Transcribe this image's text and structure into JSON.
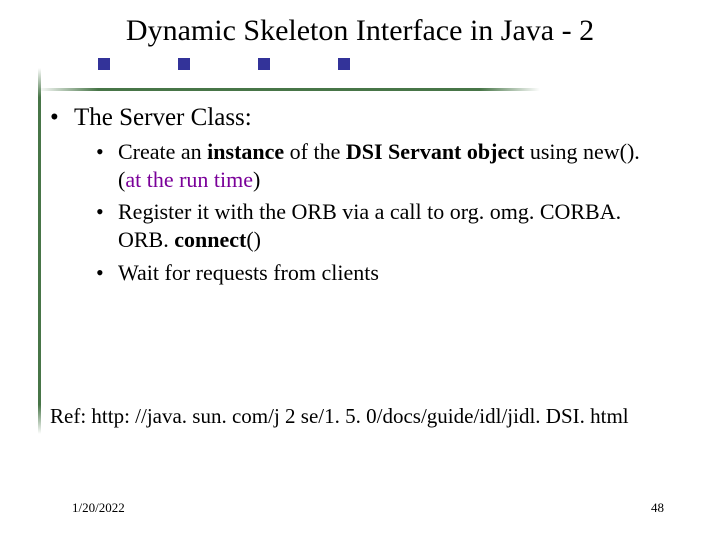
{
  "title": "Dynamic Skeleton Interface in Java - 2",
  "heading": {
    "marker": "•",
    "text": "The Server Class:"
  },
  "bullets": [
    {
      "marker": "•",
      "pre": "Create an ",
      "bold1": "instance",
      "mid": " of the ",
      "bold2": "DSI Servant object",
      "post1": " using new(). (",
      "runtime": "at the run time",
      "post2": ")"
    },
    {
      "marker": "•",
      "pre": "Register it with the ORB via a call to org. omg. CORBA. ORB. ",
      "bold": "connect",
      "post": "()"
    },
    {
      "marker": "•",
      "text": "Wait for requests from clients"
    }
  ],
  "ref": "Ref:  http: //java. sun. com/j 2 se/1. 5. 0/docs/guide/idl/jidl. DSI. html",
  "footer": {
    "date": "1/20/2022",
    "page": "48"
  },
  "dots": {
    "count": 4
  }
}
